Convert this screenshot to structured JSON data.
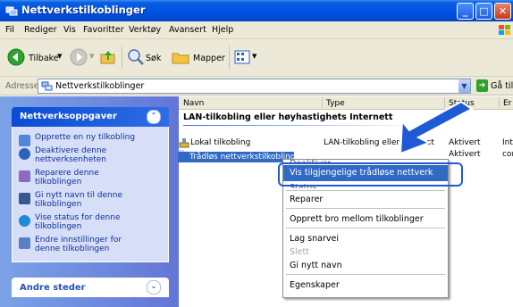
{
  "window": {
    "title": "Nettverkstilkoblinger",
    "min": "_",
    "max": "□",
    "close": "✕"
  },
  "menu": [
    "Fil",
    "Rediger",
    "Vis",
    "Favoritter",
    "Verktøy",
    "Avansert",
    "Hjelp"
  ],
  "toolbar": {
    "back": "Tilbake",
    "search": "Søk",
    "folders": "Mapper"
  },
  "address": {
    "label": "Adresse",
    "value": "Nettverkstilkoblinger",
    "go": "Gå til"
  },
  "tasks": {
    "title": "Nettverksoppgaver",
    "items": [
      "Opprette en ny tilkobling",
      "Deaktivere denne nettverksenheten",
      "Reparere denne tilkoblingen",
      "Gi nytt navn til denne tilkoblingen",
      "Vise status for denne tilkoblingen",
      "Endre innstillinger for denne tilkoblingen"
    ]
  },
  "other_places": {
    "title": "Andre steder"
  },
  "columns": [
    "Navn",
    "Type",
    "Status",
    "Er"
  ],
  "group": "LAN-tilkobling eller høyhastighets Internett",
  "rows": [
    {
      "name": "Lokal tilkobling",
      "type": "LAN-tilkobling eller høyhasti...",
      "status": "Aktivert",
      "extra": "Int"
    },
    {
      "name": "Trådløs nettverkstilkobling",
      "type": "",
      "status": "Aktivert",
      "extra": "cor"
    }
  ],
  "context_menu": {
    "highlighted": "Vis tilgjengelige trådløse nettverk",
    "items": [
      "Reparer",
      "Opprett bro mellom tilkoblinger",
      "Lag snarvei",
      "Slett",
      "Gi nytt navn",
      "Egenskaper"
    ],
    "partial_top": "Deaktiver",
    "partial_under": "Status"
  },
  "colors": {
    "xp_blue": "#0055e5",
    "selection": "#316ac5",
    "arrow": "#1f5ad6",
    "task_link": "#0c2f9a"
  }
}
